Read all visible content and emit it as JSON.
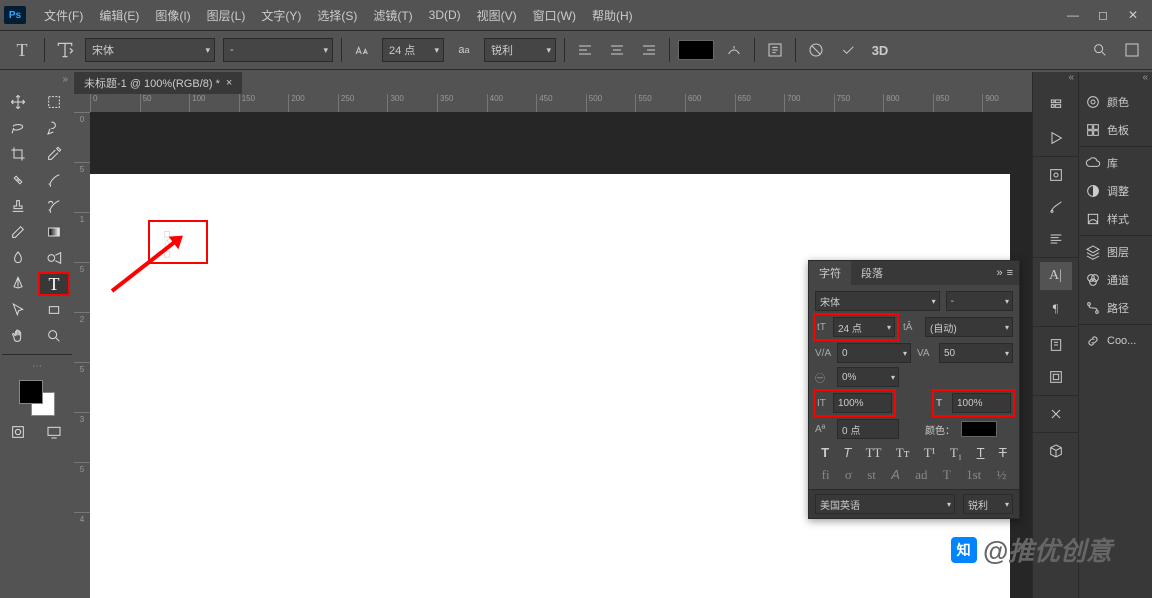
{
  "app": {
    "logo": "Ps"
  },
  "menu": [
    "文件(F)",
    "编辑(E)",
    "图像(I)",
    "图层(L)",
    "文字(Y)",
    "选择(S)",
    "滤镜(T)",
    "3D(D)",
    "视图(V)",
    "窗口(W)",
    "帮助(H)"
  ],
  "optbar": {
    "font": "宋体",
    "style": "-",
    "size": "24 点",
    "aa": "锐利"
  },
  "doc": {
    "title": "未标题-1 @ 100%(RGB/8) *"
  },
  "ruler_h": [
    "0",
    "50",
    "100",
    "150",
    "200",
    "250",
    "300",
    "350",
    "400",
    "450",
    "500",
    "550",
    "600",
    "650",
    "700",
    "750",
    "800",
    "850",
    "900"
  ],
  "ruler_v": [
    "0",
    "5",
    "1",
    "5",
    "2",
    "5",
    "3",
    "5",
    "4"
  ],
  "char": {
    "tab_char": "字符",
    "tab_para": "段落",
    "font": "宋体",
    "style": "-",
    "size": "24 点",
    "leading": "(自动)",
    "kerning": "0",
    "tracking": "50",
    "scale": "0%",
    "vscale": "100%",
    "hscale": "100%",
    "baseline": "0 点",
    "color_label": "颜色：",
    "lang": "美国英语",
    "aa": "锐利"
  },
  "panels": {
    "color": "颜色",
    "swatches": "色板",
    "libraries": "库",
    "adjustments": "调整",
    "styles": "样式",
    "layers": "图层",
    "channels": "通道",
    "paths": "路径",
    "cc": "Coo..."
  },
  "watermark": "@推优创意"
}
